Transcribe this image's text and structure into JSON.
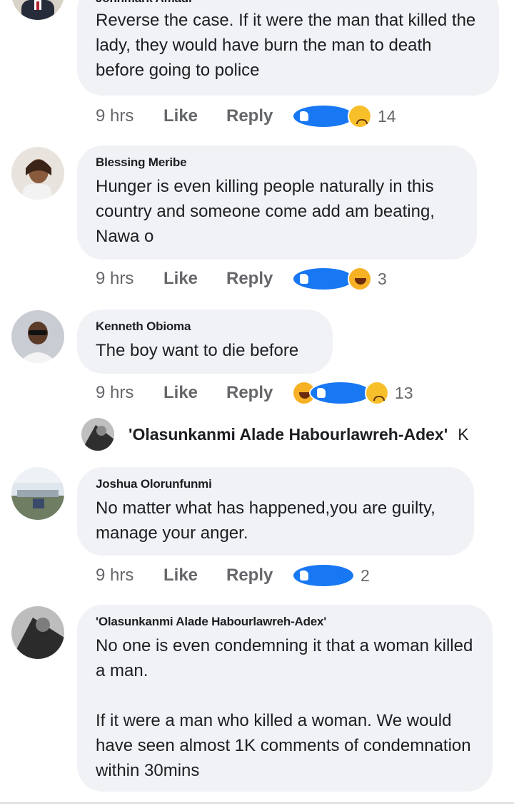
{
  "comments": [
    {
      "author": "Johnmark Amadi",
      "text": "Reverse the case. If it were the man that killed the lady, they would have burn the man to death before going to police",
      "time": "9 hrs",
      "like": "Like",
      "reply": "Reply",
      "reactions": [
        "like-reaction-icon",
        "sad-reaction-icon"
      ],
      "reaction_count": "14"
    },
    {
      "author": "Blessing Meribe",
      "text": "Hunger is even killing people naturally in this country and someone come add am beating, Nawa o",
      "time": "9 hrs",
      "like": "Like",
      "reply": "Reply",
      "reactions": [
        "like-reaction-icon",
        "haha-reaction-icon"
      ],
      "reaction_count": "3"
    },
    {
      "author": "Kenneth Obioma",
      "text": "The boy want to die before",
      "time": "9 hrs",
      "like": "Like",
      "reply": "Reply",
      "reactions": [
        "haha-reaction-icon",
        "like-reaction-icon",
        "sad-reaction-icon"
      ],
      "reaction_count": "13"
    },
    {
      "author": "Joshua Olorunfunmi",
      "text": "No matter what has happened,you are guilty, manage your anger.",
      "time": "9 hrs",
      "like": "Like",
      "reply": "Reply",
      "reactions": [
        "like-reaction-icon"
      ],
      "reaction_count": "2"
    },
    {
      "author": "'Olasunkanmi Alade Habourlawreh-Adex'",
      "text": "No one is even condemning it that a woman killed a man.\n\nIf it were a man who killed a woman. We would have seen almost 1K comments of condemnation within 30mins"
    }
  ],
  "mention": {
    "name": "'Olasunkanmi Alade Habourlawreh-Adex'",
    "tail": "K"
  },
  "colors": {
    "bubble": "#f0f2f5",
    "muted_text": "#65676b",
    "like_blue": "#1877f2",
    "reaction_yellow": "#f7b125"
  }
}
